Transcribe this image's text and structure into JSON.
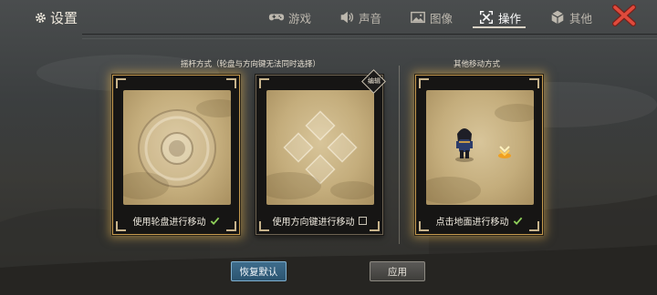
{
  "header": {
    "title": "设置",
    "tabs": [
      {
        "label": "游戏",
        "icon": "gamepad-icon",
        "active": false
      },
      {
        "label": "声音",
        "icon": "speaker-icon",
        "active": false
      },
      {
        "label": "图像",
        "icon": "image-icon",
        "active": false
      },
      {
        "label": "操作",
        "icon": "controls-icon",
        "active": true
      },
      {
        "label": "其他",
        "icon": "cube-icon",
        "active": false
      }
    ],
    "close_icon": "close-icon"
  },
  "sections": {
    "joystick_label": "摇杆方式（轮盘与方向键无法同时选择）",
    "other_label": "其他移动方式"
  },
  "cards": [
    {
      "label": "使用轮盘进行移动",
      "selected": true
    },
    {
      "label": "使用方向键进行移动",
      "selected": false,
      "badge": "编辑"
    },
    {
      "label": "点击地面进行移动",
      "selected": true
    }
  ],
  "buttons": {
    "restore": "恢复默认",
    "apply": "应用"
  },
  "colors": {
    "selected_glow": "#e6b450",
    "restore_button": "#3e6c8c",
    "check": "#8fd05a",
    "close_icon": "#e04a3c"
  }
}
